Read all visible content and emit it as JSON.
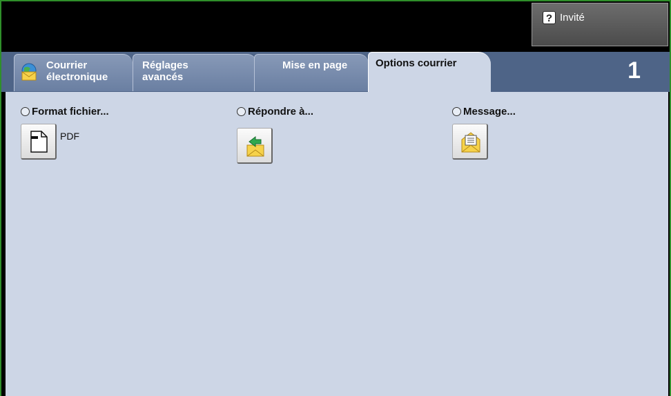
{
  "user": {
    "label": "Invité",
    "icon": "question-icon"
  },
  "tabs": [
    {
      "line1": "Courrier",
      "line2": "électronique",
      "icon": "email-globe-icon"
    },
    {
      "line1": "Réglages",
      "line2": "avancés"
    },
    {
      "line1": "Mise en page",
      "line2": ""
    },
    {
      "line1": "Options courrier",
      "line2": "",
      "active": true
    }
  ],
  "page_number": "1",
  "options": {
    "file_format": {
      "label": "Format fichier...",
      "value": "PDF",
      "icon": "document-icon"
    },
    "reply_to": {
      "label": "Répondre à...",
      "icon": "reply-envelope-icon"
    },
    "message": {
      "label": "Message...",
      "icon": "message-envelope-icon"
    }
  },
  "colors": {
    "tabbar": "#4e6487",
    "panel": "#cdd6e6",
    "frame": "#2f8f2a"
  }
}
